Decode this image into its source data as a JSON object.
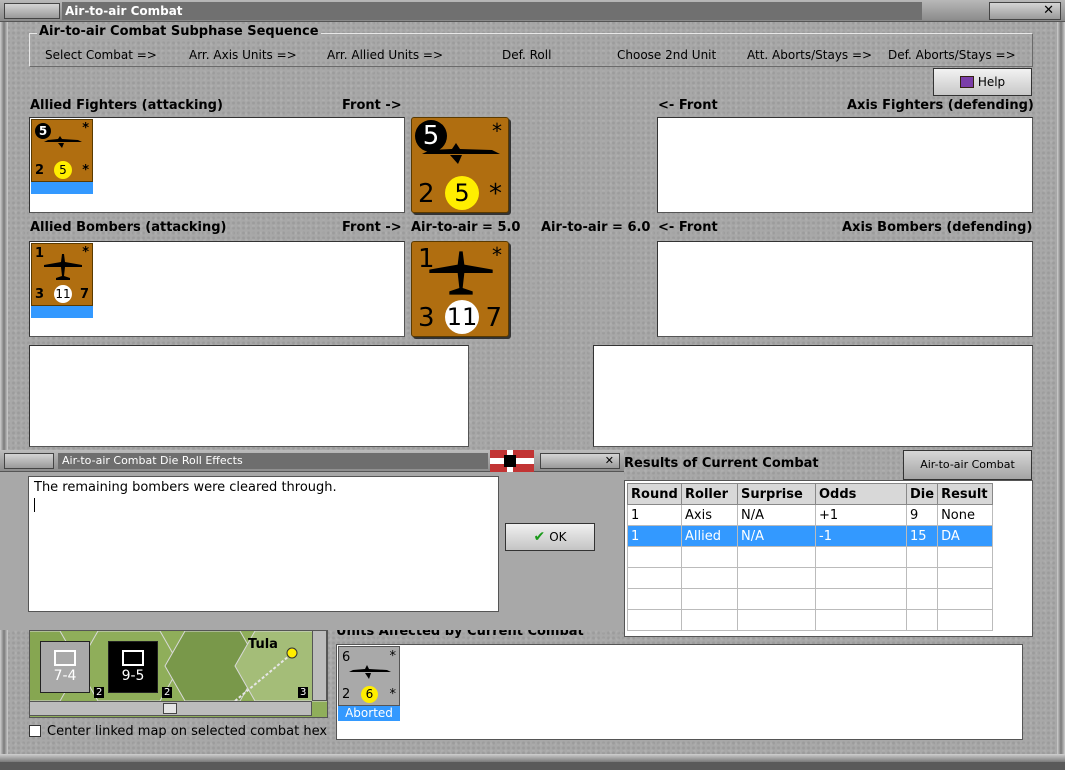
{
  "window": {
    "title": "Air-to-air Combat"
  },
  "sequence": {
    "title": "Air-to-air Combat Subphase Sequence",
    "steps": [
      "Select Combat =>",
      "Arr. Axis Units =>",
      "Arr. Allied Units =>",
      "Def. Roll",
      "Choose 2nd Unit",
      "Att. Aborts/Stays =>",
      "Def. Aborts/Stays =>"
    ]
  },
  "help_button": "Help",
  "fighters": {
    "allied_label": "Allied Fighters (attacking)",
    "allied_front": "Front ->",
    "axis_front": "<- Front",
    "axis_label": "Axis Fighters (defending)",
    "counter": {
      "top_left": "5",
      "top_right": "*",
      "bottom_left": "2",
      "center": "5",
      "bottom_right": "*",
      "center_color": "#ffee00"
    }
  },
  "bombers": {
    "allied_label": "Allied Bombers (attacking)",
    "allied_front": "Front ->",
    "axis_front": "<- Front",
    "axis_label": "Axis Bombers (defending)",
    "allied_air_to_air": "Air-to-air = 5.0",
    "axis_air_to_air": "Air-to-air = 6.0",
    "counter": {
      "top_left": "1",
      "top_right": "*",
      "bottom_left": "3",
      "center": "11",
      "bottom_right": "7",
      "center_color": "#ffffff"
    }
  },
  "die_roll": {
    "title": "Air-to-air Combat Die Roll Effects",
    "message": "The remaining bombers were cleared through.",
    "ok_label": "OK"
  },
  "results": {
    "title": "Results of Current Combat",
    "chart_button": "Air-to-air Combat Chart",
    "columns": [
      "Round",
      "Roller",
      "Surprise",
      "Odds",
      "Die",
      "Result"
    ],
    "rows": [
      [
        "1",
        "Axis",
        "N/A",
        "+1",
        "9",
        "None"
      ],
      [
        "1",
        "Allied",
        "N/A",
        "-1",
        "15",
        "DA"
      ]
    ],
    "selected_row": 1
  },
  "units_affected": {
    "title": "Units Affected by Current Combat",
    "counter": {
      "top_left": "6",
      "top_right": "*",
      "bottom_left": "2",
      "center": "6",
      "bottom_right": "*"
    },
    "status": "Aborted"
  },
  "map": {
    "city": "Tula",
    "units": [
      {
        "strength": "7-4",
        "style": "light"
      },
      {
        "strength": "9-5",
        "style": "dark"
      }
    ],
    "hex_numbers": [
      "2",
      "2",
      "3"
    ]
  },
  "center_map_checkbox": {
    "label": "Center linked map on selected combat hex",
    "checked": false
  },
  "colors": {
    "counter_brown": "#b06e10",
    "selection_blue": "#3399ff",
    "window_gray": "#a8a8a8"
  }
}
